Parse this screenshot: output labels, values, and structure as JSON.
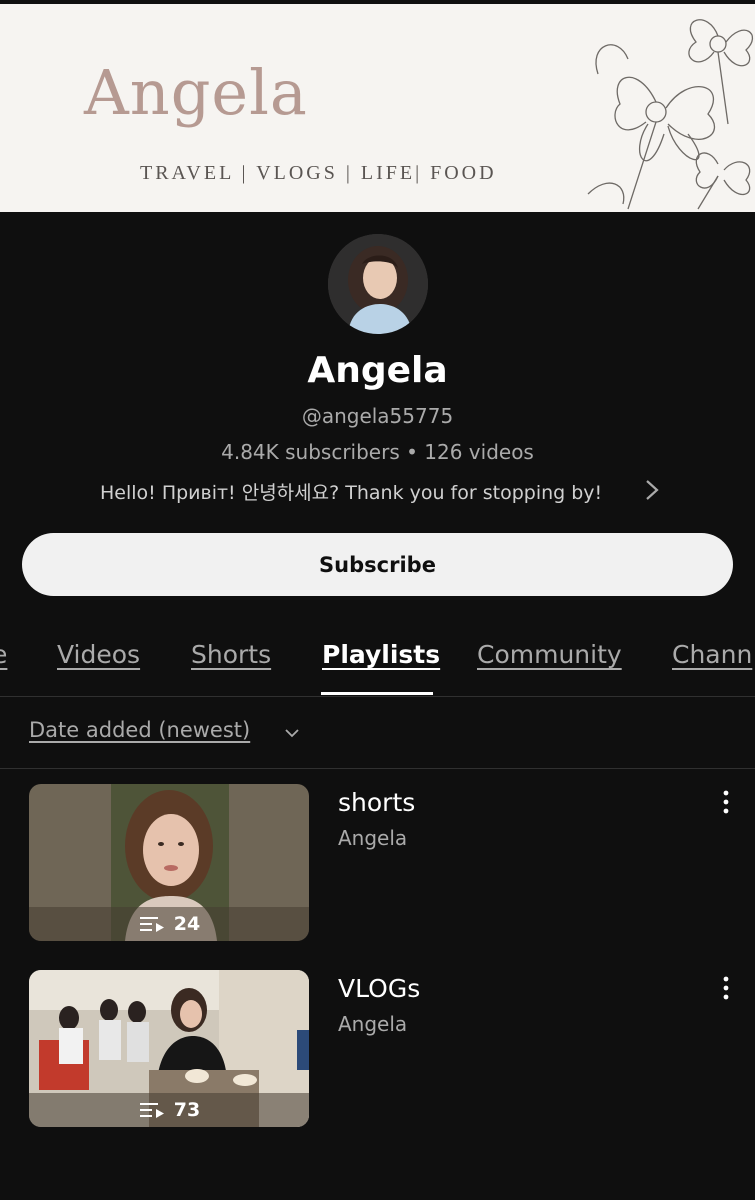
{
  "banner": {
    "title": "Angela",
    "tagline": "TRAVEL | VLOGS | LIFE| FOOD"
  },
  "channel": {
    "name": "Angela",
    "handle": "@angela55775",
    "stats": "4.84K subscribers • 126 videos",
    "description": "Hello! Привіт! 안녕하세요? Thank you for stopping by!"
  },
  "subscribe_label": "Subscribe",
  "tabs": [
    {
      "label": "e"
    },
    {
      "label": "Videos"
    },
    {
      "label": "Shorts"
    },
    {
      "label": "Playlists"
    },
    {
      "label": "Community"
    },
    {
      "label": "Chann"
    }
  ],
  "sort_label": "Date added (newest)",
  "playlists": [
    {
      "title": "shorts",
      "owner": "Angela",
      "count": "24"
    },
    {
      "title": "VLOGs",
      "owner": "Angela",
      "count": "73"
    }
  ],
  "colors": {
    "background": "#0f0f0f",
    "banner_bg": "#f6f4f1",
    "banner_title": "#b69a92",
    "secondary_text": "#aaaaaa"
  }
}
